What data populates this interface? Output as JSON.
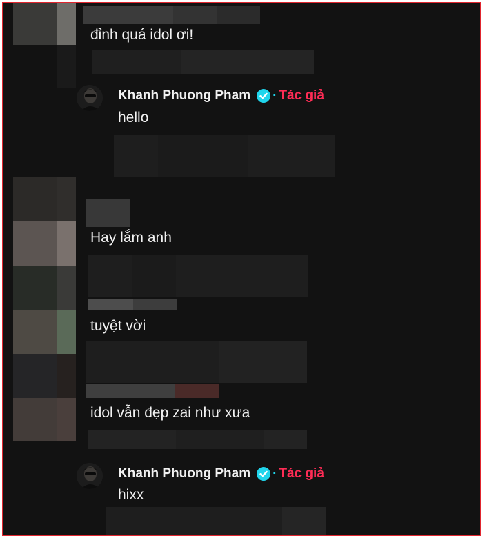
{
  "colors": {
    "background": "#121212",
    "text": "#f1f1f1",
    "verified": "#20d5ec",
    "author_tag": "#fe2c55",
    "border": "#e0262f"
  },
  "comments": [
    {
      "text": "đỉnh quá idol ơi!"
    },
    {
      "text": "Hay lắm anh"
    },
    {
      "text": "tuyệt vời"
    },
    {
      "text": "idol vẫn đẹp zai như xưa"
    }
  ],
  "replies": [
    {
      "author": "Khanh Phuong Pham",
      "separator": "·",
      "tag": "Tác giả",
      "text": "hello",
      "verified_icon": "verified-check-icon"
    },
    {
      "author": "Khanh Phuong Pham",
      "separator": "·",
      "tag": "Tác giả",
      "text": "hixx",
      "verified_icon": "verified-check-icon"
    }
  ]
}
